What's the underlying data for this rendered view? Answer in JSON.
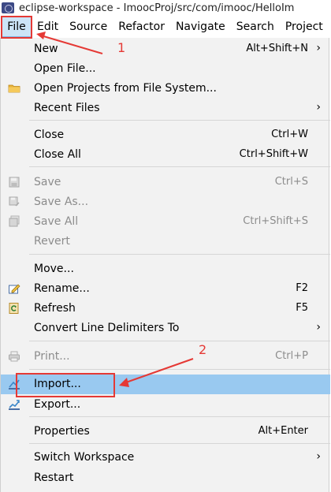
{
  "window": {
    "title": "eclipse-workspace - ImoocProj/src/com/imooc/HelloIm"
  },
  "menubar": {
    "items": [
      {
        "label": "File"
      },
      {
        "label": "Edit"
      },
      {
        "label": "Source"
      },
      {
        "label": "Refactor"
      },
      {
        "label": "Navigate"
      },
      {
        "label": "Search"
      },
      {
        "label": "Project"
      }
    ]
  },
  "file_menu": {
    "items": [
      {
        "label": "New",
        "shortcut": "Alt+Shift+N",
        "submenu": true,
        "enabled": true
      },
      {
        "label": "Open File...",
        "enabled": true
      },
      {
        "label": "Open Projects from File System...",
        "enabled": true,
        "icon": "folder-icon"
      },
      {
        "label": "Recent Files",
        "submenu": true,
        "enabled": true
      },
      {
        "label": "Close",
        "shortcut": "Ctrl+W",
        "enabled": true
      },
      {
        "label": "Close All",
        "shortcut": "Ctrl+Shift+W",
        "enabled": true
      },
      {
        "label": "Save",
        "shortcut": "Ctrl+S",
        "enabled": false,
        "icon": "save-icon"
      },
      {
        "label": "Save As...",
        "enabled": false,
        "icon": "save-as-icon"
      },
      {
        "label": "Save All",
        "shortcut": "Ctrl+Shift+S",
        "enabled": false,
        "icon": "save-all-icon"
      },
      {
        "label": "Revert",
        "enabled": false
      },
      {
        "label": "Move...",
        "enabled": true
      },
      {
        "label": "Rename...",
        "shortcut": "F2",
        "enabled": true,
        "icon": "rename-icon"
      },
      {
        "label": "Refresh",
        "shortcut": "F5",
        "enabled": true,
        "icon": "refresh-icon"
      },
      {
        "label": "Convert Line Delimiters To",
        "submenu": true,
        "enabled": true
      },
      {
        "label": "Print...",
        "shortcut": "Ctrl+P",
        "enabled": false,
        "icon": "print-icon"
      },
      {
        "label": "Import...",
        "enabled": true,
        "highlighted": true,
        "icon": "import-icon"
      },
      {
        "label": "Export...",
        "enabled": true,
        "icon": "export-icon"
      },
      {
        "label": "Properties",
        "shortcut": "Alt+Enter",
        "enabled": true
      },
      {
        "label": "Switch Workspace",
        "submenu": true,
        "enabled": true
      },
      {
        "label": "Restart",
        "enabled": true
      }
    ],
    "submenu_arrow": "›"
  },
  "annotations": {
    "step1": "1",
    "step2": "2",
    "color": "#e53935"
  },
  "colors": {
    "highlight": "#99c9f0",
    "menu_bg": "#f2f2f2",
    "disabled_text": "#8c8c8c"
  }
}
